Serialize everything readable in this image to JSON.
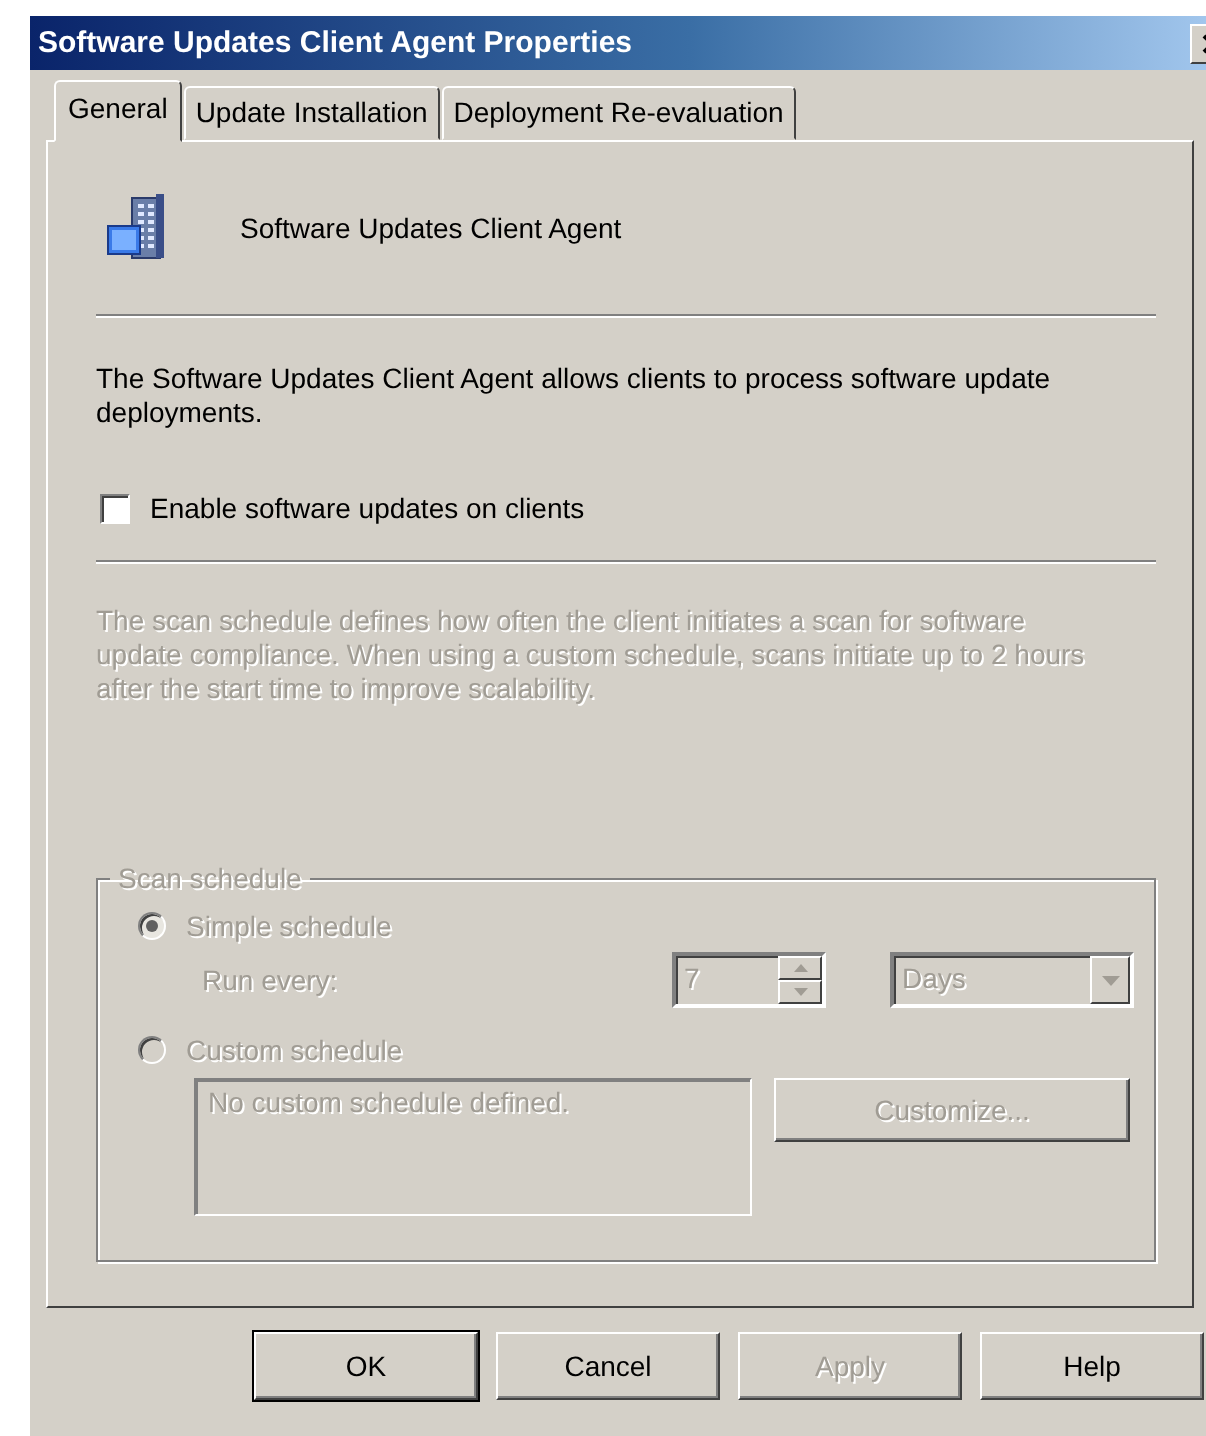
{
  "window": {
    "title": "Software Updates Client Agent Properties"
  },
  "tabs": [
    {
      "label": "General",
      "selected": true
    },
    {
      "label": "Update Installation",
      "selected": false
    },
    {
      "label": "Deployment Re-evaluation",
      "selected": false
    }
  ],
  "header": {
    "title": "Software Updates Client Agent"
  },
  "description": "The Software Updates Client Agent allows clients to process software update deployments.",
  "enable_checkbox": {
    "label": "Enable software updates on clients",
    "checked": false
  },
  "schedule_note": {
    "text": "The scan schedule defines how often the client initiates a scan for software update compliance. When using a custom schedule, scans initiate up to 2 hours after the start time to improve scalability.",
    "disabled": true
  },
  "scan_schedule": {
    "title": "Scan schedule",
    "disabled": true,
    "options": [
      {
        "label": "Simple schedule",
        "selected": true
      },
      {
        "label": "Custom schedule",
        "selected": false
      }
    ],
    "run_every": {
      "label": "Run every:",
      "value": "7",
      "unit": "Days"
    },
    "custom_text": "No custom schedule defined.",
    "customize_button": "Customize..."
  },
  "buttons": [
    {
      "label": "OK",
      "default": true,
      "disabled": false
    },
    {
      "label": "Cancel",
      "default": false,
      "disabled": false
    },
    {
      "label": "Apply",
      "default": false,
      "disabled": true
    },
    {
      "label": "Help",
      "default": false,
      "disabled": false
    }
  ]
}
